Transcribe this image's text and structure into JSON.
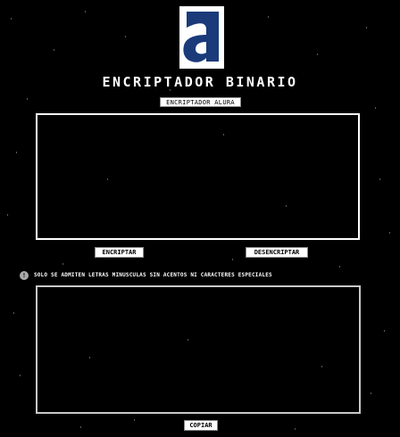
{
  "header": {
    "logo_letter": "a",
    "title": "ENCRIPTADOR BINARIO",
    "subtitle": "ENCRIPTADOR ALURA"
  },
  "input": {
    "value": "",
    "placeholder": ""
  },
  "actions": {
    "encrypt_label": "ENCRIPTAR",
    "decrypt_label": "DESENCRIPTAR"
  },
  "notice": {
    "icon": "info-icon",
    "icon_glyph": "!",
    "text": "SOLO SE ADMITEN LETRAS MINUSCULAS SIN ACENTOS NI CARACTERES ESPECIALES"
  },
  "output": {
    "value": ""
  },
  "copy_label": "COPIAR",
  "colors": {
    "background": "#000000",
    "logo_blue": "#1a3a7a",
    "text": "#ffffff",
    "button_bg": "#ffffff"
  }
}
